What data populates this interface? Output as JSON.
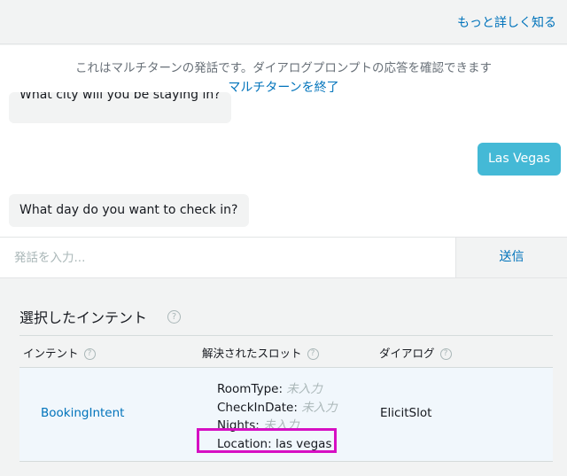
{
  "header": {
    "learn_more": "もっと詳しく知る"
  },
  "chat": {
    "banner": "これはマルチターンの発話です。ダイアログプロンプトの応答を確認できます",
    "end_multi_turn": "マルチターンを終了",
    "messages": [
      {
        "from": "bot",
        "text": "What city will you be staying in?"
      },
      {
        "from": "user",
        "text": "Las Vegas"
      },
      {
        "from": "bot",
        "text": "What day do you want to check in?"
      }
    ]
  },
  "composer": {
    "placeholder": "発話を入力...",
    "send_label": "送信"
  },
  "intent_panel": {
    "title": "選択したインテント",
    "info_glyph": "?",
    "columns": [
      "インテント",
      "解決されたスロット",
      "ダイアログ"
    ],
    "row": {
      "intent": "BookingIntent",
      "slots": [
        {
          "name": "RoomType:",
          "value": "未入力"
        },
        {
          "name": "CheckInDate:",
          "value": "未入力"
        },
        {
          "name": "Nights:",
          "value": "未入力"
        },
        {
          "name": "Location:",
          "value": "las vegas"
        }
      ],
      "dialog": "ElicitSlot"
    }
  },
  "colors": {
    "link": "#0073bb",
    "user_bubble": "#44b9d6",
    "highlight_box": "#d60fc3"
  }
}
